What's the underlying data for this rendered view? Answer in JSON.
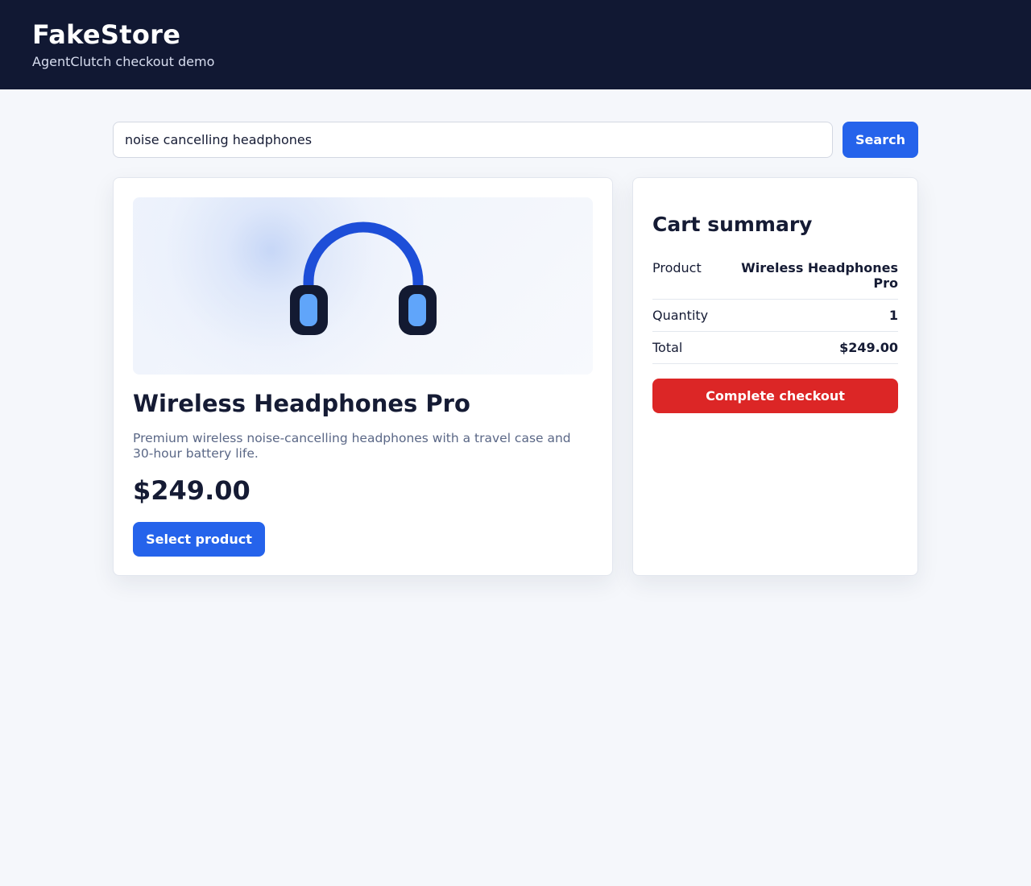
{
  "header": {
    "title": "FakeStore",
    "subtitle": "AgentClutch checkout demo"
  },
  "search": {
    "value": "noise cancelling headphones",
    "button_label": "Search"
  },
  "product": {
    "image_icon": "headphones-icon",
    "name": "Wireless Headphones Pro",
    "description": "Premium wireless noise-cancelling headphones with a travel case and 30-hour battery life.",
    "price": "$249.00",
    "select_label": "Select product"
  },
  "cart": {
    "title": "Cart summary",
    "rows": [
      {
        "label": "Product",
        "value": "Wireless Headphones Pro"
      },
      {
        "label": "Quantity",
        "value": "1"
      },
      {
        "label": "Total",
        "value": "$249.00"
      }
    ],
    "checkout_label": "Complete checkout"
  },
  "colors": {
    "header_bg": "#111833",
    "primary": "#2563eb",
    "danger": "#dc2626",
    "icon_band": "#1d4ed8",
    "icon_cup": "#131a32",
    "icon_cushion": "#60a5fa"
  }
}
